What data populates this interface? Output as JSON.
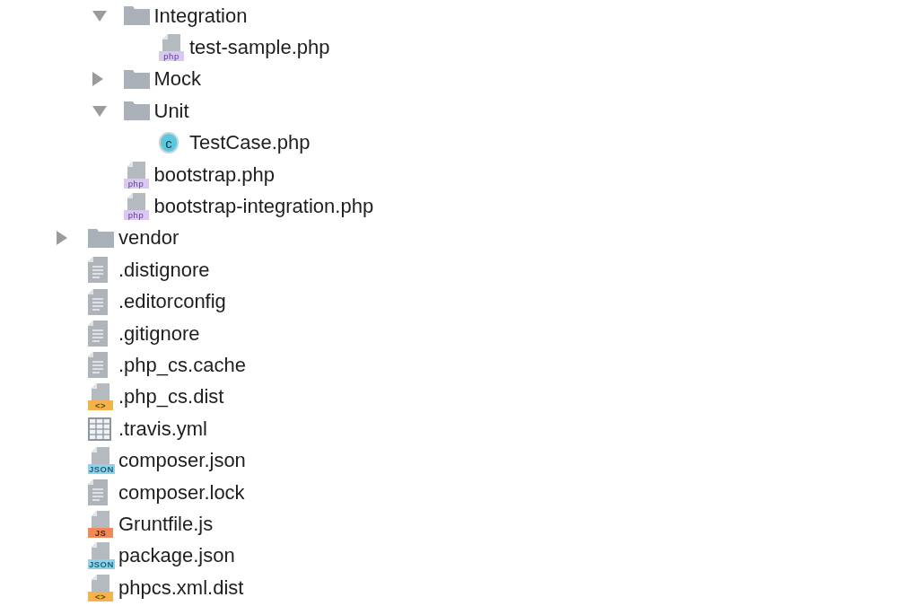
{
  "tree": [
    {
      "children": [
        {
          "name": "Integration",
          "kind": "folder",
          "expanded": true,
          "children": [
            {
              "name": "test-sample.php",
              "kind": "php",
              "badge": "php"
            }
          ]
        },
        {
          "name": "Mock",
          "kind": "folder",
          "expanded": false
        },
        {
          "name": "Unit",
          "kind": "folder",
          "expanded": true,
          "children": [
            {
              "name": "TestCase.php",
              "kind": "class",
              "badge": "c"
            }
          ]
        },
        {
          "name": "bootstrap.php",
          "kind": "php",
          "badge": "php"
        },
        {
          "name": "bootstrap-integration.php",
          "kind": "php",
          "badge": "php"
        }
      ]
    },
    {
      "name": "vendor",
      "kind": "folder",
      "expanded": false
    },
    {
      "name": ".distignore",
      "kind": "text"
    },
    {
      "name": ".editorconfig",
      "kind": "text"
    },
    {
      "name": ".gitignore",
      "kind": "text"
    },
    {
      "name": ".php_cs.cache",
      "kind": "text"
    },
    {
      "name": ".php_cs.dist",
      "kind": "markup",
      "badge": "<>"
    },
    {
      "name": ".travis.yml",
      "kind": "table"
    },
    {
      "name": "composer.json",
      "kind": "json",
      "badge": "JSON"
    },
    {
      "name": "composer.lock",
      "kind": "text"
    },
    {
      "name": "Gruntfile.js",
      "kind": "js",
      "badge": "JS"
    },
    {
      "name": "package.json",
      "kind": "json",
      "badge": "JSON"
    },
    {
      "name": "phpcs.xml.dist",
      "kind": "markup",
      "badge": "<>"
    }
  ]
}
